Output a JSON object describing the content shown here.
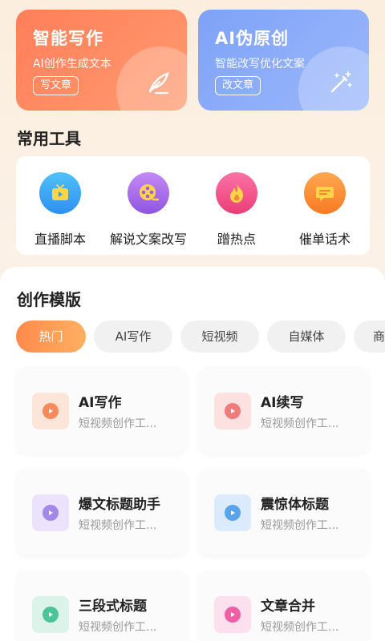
{
  "feature_cards": [
    {
      "title": "智能写作",
      "subtitle": "AI创作生成文本",
      "button": "写文章",
      "icon": "feather-icon"
    },
    {
      "title": "AI伪原创",
      "subtitle": "智能改写优化文案",
      "button": "改文章",
      "icon": "magic-wand-icon"
    }
  ],
  "common_tools": {
    "title": "常用工具",
    "items": [
      {
        "label": "直播脚本",
        "icon": "tv-icon",
        "color": "#3aa7f2"
      },
      {
        "label": "解说文案改写",
        "icon": "film-reel-icon",
        "color": "#a56ae8"
      },
      {
        "label": "蹭热点",
        "icon": "flame-icon",
        "color": "#f04f86"
      },
      {
        "label": "催单话术",
        "icon": "message-icon",
        "color": "#fb8a34"
      }
    ]
  },
  "templates": {
    "title": "创作模版",
    "tabs": [
      "热门",
      "AI写作",
      "短视频",
      "自媒体",
      "商"
    ],
    "active_tab": 0,
    "cards": [
      {
        "title": "AI写作",
        "subtitle": "短视频创作工...",
        "icon_bg": "#fde6d9",
        "icon_color": "#f58a5a"
      },
      {
        "title": "AI续写",
        "subtitle": "短视频创作工...",
        "icon_bg": "#fde1e1",
        "icon_color": "#f07b7b"
      },
      {
        "title": "爆文标题助手",
        "subtitle": "短视频创作工...",
        "icon_bg": "#ebe3fb",
        "icon_color": "#a488e8"
      },
      {
        "title": "震惊体标题",
        "subtitle": "短视频创作工...",
        "icon_bg": "#dcebfb",
        "icon_color": "#58a5ec"
      },
      {
        "title": "三段式标题",
        "subtitle": "短视频创作工...",
        "icon_bg": "#dcf3ea",
        "icon_color": "#4cc49b"
      },
      {
        "title": "文章合并",
        "subtitle": "短视频创作工...",
        "icon_bg": "#fde0ee",
        "icon_color": "#ee5fa5"
      }
    ]
  }
}
